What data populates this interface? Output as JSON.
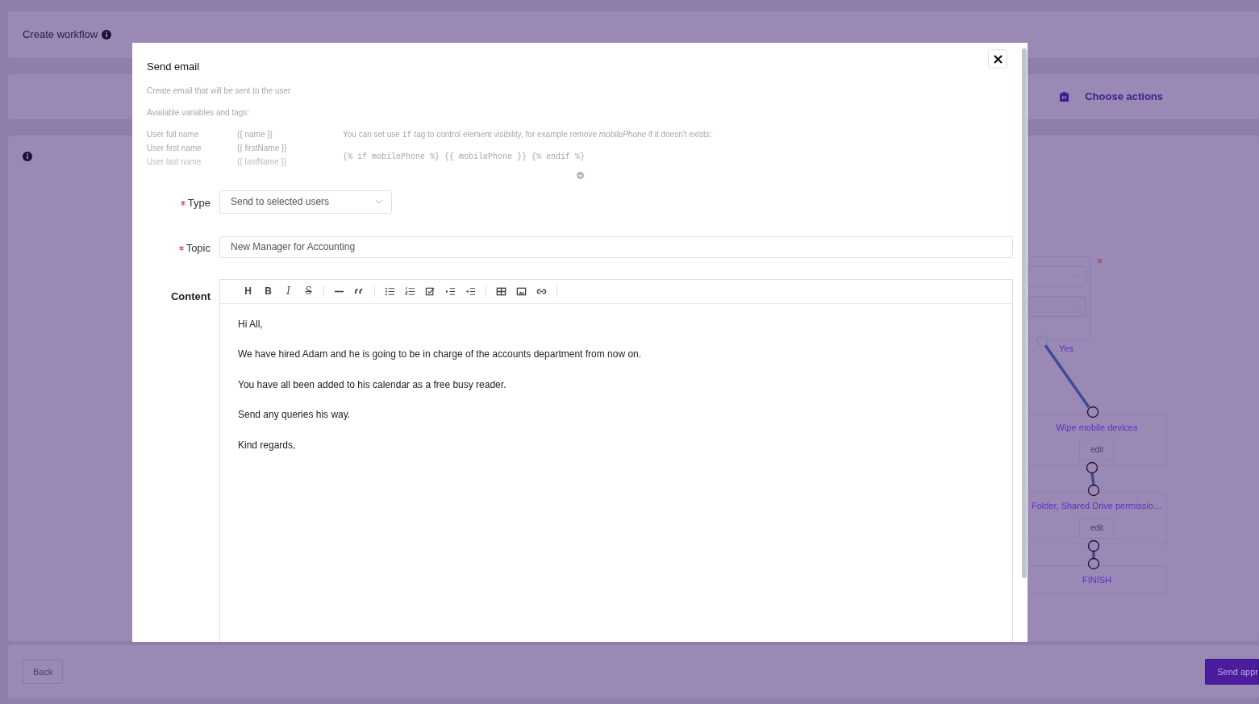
{
  "page": {
    "title": "Create workflow",
    "actions_label": "Choose actions"
  },
  "diagram": {
    "condition": {
      "remove": "×",
      "branch_label": "Yes"
    },
    "nodes": [
      {
        "label": "Wipe mobile devices",
        "button": "edit"
      },
      {
        "label": "Folder, Shared Drive permissio…",
        "button": "edit"
      },
      {
        "label": "FINISH"
      }
    ]
  },
  "footer": {
    "back": "Back",
    "send": "Send appr"
  },
  "modal": {
    "title": "Send email",
    "description": "Create email that will be sent to the user",
    "variables_heading": "Available variables and tags:",
    "variables": [
      {
        "label": "User full name",
        "tag": "{{ name }}"
      },
      {
        "label": "User first name",
        "tag": "{{ firstName }}"
      },
      {
        "label": "User last name",
        "tag": "{{ lastName }}"
      }
    ],
    "tip": [
      {
        "kind": "text",
        "text": "You can set use "
      },
      {
        "kind": "code",
        "text": "if"
      },
      {
        "kind": "text",
        "text": " tag to control element visibility, for example remove "
      },
      {
        "kind": "em",
        "text": "mobilePhone"
      },
      {
        "kind": "text",
        "text": " if it doesn't exists:"
      }
    ],
    "code_example": "{% if mobilePhone %} {{ mobilePhone }} {% endif %}",
    "fields": [
      {
        "kind": "select",
        "label": "Type",
        "required": true,
        "value": "Send to selected users"
      },
      {
        "kind": "text",
        "label": "Topic",
        "required": true,
        "value": "New Manager for Accounting"
      },
      {
        "kind": "editor",
        "label": "Content",
        "required": false,
        "toolbar": [
          [
            {
              "kind": "heading",
              "glyph": "H"
            },
            {
              "kind": "bold",
              "glyph": "B"
            },
            {
              "kind": "italic",
              "glyph": "I"
            },
            {
              "kind": "strike",
              "glyph": "S"
            }
          ],
          [
            {
              "kind": "rule"
            },
            {
              "kind": "quote"
            }
          ],
          [
            {
              "kind": "bullet-list"
            },
            {
              "kind": "numbered-list"
            },
            {
              "kind": "task-list"
            },
            {
              "kind": "indent"
            },
            {
              "kind": "outdent"
            }
          ],
          [
            {
              "kind": "table"
            },
            {
              "kind": "image"
            },
            {
              "kind": "link"
            }
          ]
        ],
        "paragraphs": [
          "Hi All,",
          "We have hired Adam and he is going to be in charge of the accounts department from now on.",
          "You have all been added to his calendar as a free busy reader.",
          "Send any queries his way.",
          "Kind regards,"
        ]
      }
    ]
  }
}
